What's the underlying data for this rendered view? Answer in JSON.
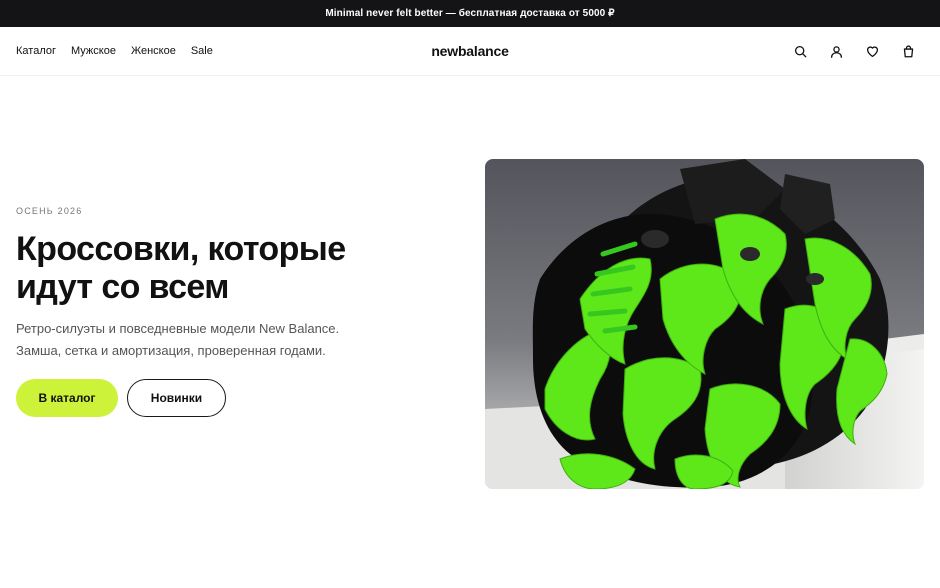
{
  "promo": {
    "text": "Minimal never felt better — бесплатная доставка от 5000 ₽"
  },
  "header": {
    "nav": [
      {
        "label": "Каталог"
      },
      {
        "label": "Мужское"
      },
      {
        "label": "Женское"
      },
      {
        "label": "Sale"
      }
    ],
    "logo": "newbalance",
    "icons": [
      "search-icon",
      "user-icon",
      "heart-icon",
      "bag-icon"
    ]
  },
  "hero": {
    "eyebrow": "ОСЕНЬ 2026",
    "title": "Кроссовки, которые идут со всем",
    "subtitle": "Ретро-силуэты и повседневные модели New Balance. Замша, сетка и амортизация, проверенная годами.",
    "primary_button": "В каталог",
    "secondary_button": "Новинки",
    "image": "sneaker-photo"
  },
  "colors": {
    "accent": "#cdf23a",
    "promo_bg": "#141416",
    "text": "#111111"
  }
}
